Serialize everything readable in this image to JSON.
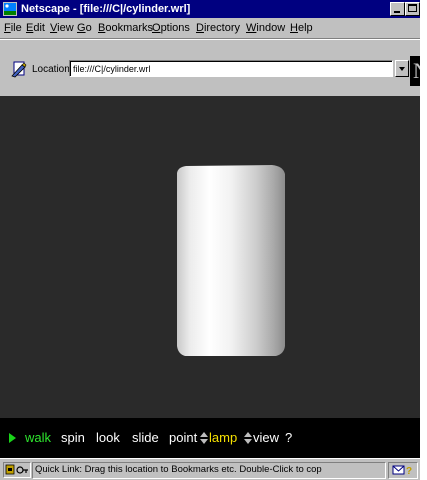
{
  "window": {
    "title": "Netscape - [file:///C|/cylinder.wrl]"
  },
  "menu": {
    "items": [
      {
        "key": "F",
        "rest": "ile"
      },
      {
        "key": "E",
        "rest": "dit"
      },
      {
        "key": "V",
        "rest": "iew"
      },
      {
        "key": "G",
        "rest": "o"
      },
      {
        "key": "B",
        "rest": "ookmarks"
      },
      {
        "key": "O",
        "rest": "ptions"
      },
      {
        "key": "D",
        "rest": "irectory"
      },
      {
        "key": "W",
        "rest": "indow"
      },
      {
        "key": "H",
        "rest": "elp"
      }
    ]
  },
  "location": {
    "label": "Location:",
    "value": "file:///C|/cylinder.wrl"
  },
  "logo": {
    "letter": "N"
  },
  "viewer": {
    "background": "#2a2a2a",
    "model": "cylinder"
  },
  "navigation": {
    "walk": "walk",
    "spin": "spin",
    "look": "look",
    "slide": "slide",
    "point": "point",
    "lamp": "lamp",
    "view": "view",
    "help": "?",
    "active_mode": "walk",
    "colors": {
      "active": "#2ee62e",
      "lamp": "#f5e000",
      "normal": "#ffffff"
    }
  },
  "status": {
    "text": "Quick Link: Drag this location to Bookmarks etc. Double-Click to cop"
  }
}
